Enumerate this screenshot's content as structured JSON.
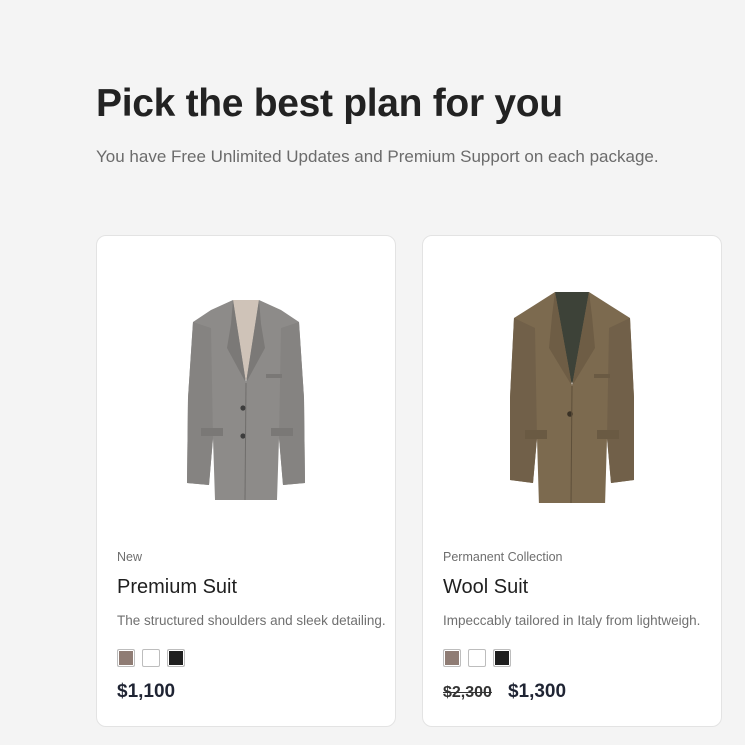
{
  "header": {
    "title": "Pick the best plan for you",
    "subtitle": "You have Free Unlimited Updates and Premium Support on each package."
  },
  "products": [
    {
      "image_icon": "grey-blazer-image",
      "tag": "New",
      "name": "Premium Suit",
      "description": "The structured shoulders and sleek detailing.",
      "swatches": [
        "#8f7c74",
        "#ffffff",
        "#1f1f1f"
      ],
      "price": "$1,100"
    },
    {
      "image_icon": "olive-blazer-image",
      "tag": "Permanent Collection",
      "name": "Wool Suit",
      "description": "Impeccably tailored in Italy from lightweigh.",
      "swatches": [
        "#8f7c74",
        "#ffffff",
        "#1f1f1f"
      ],
      "old_price": "$2,300",
      "price": "$1,300"
    }
  ]
}
